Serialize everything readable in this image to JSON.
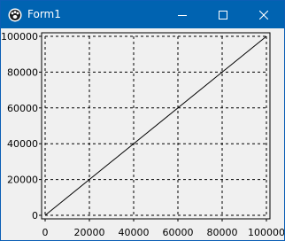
{
  "window": {
    "title": "Form1",
    "controls": {
      "minimize": "minimize",
      "maximize": "maximize",
      "close": "close"
    },
    "colors": {
      "titlebar": "#0063b1",
      "client": "#f0f0f0"
    }
  },
  "chart_data": {
    "type": "line",
    "title": "",
    "xlabel": "",
    "ylabel": "",
    "xlim": [
      0,
      100000
    ],
    "ylim": [
      0,
      100000
    ],
    "x_ticks": [
      0,
      20000,
      40000,
      60000,
      80000,
      100000
    ],
    "y_ticks": [
      0,
      20000,
      40000,
      60000,
      80000,
      100000
    ],
    "grid": "dashed",
    "series": [
      {
        "x": [
          0,
          100000
        ],
        "y": [
          0,
          100000
        ],
        "color": "#000000"
      }
    ]
  }
}
